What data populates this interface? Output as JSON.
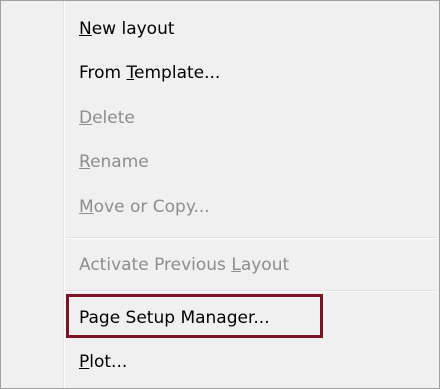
{
  "menu": {
    "items": [
      {
        "pre": "",
        "u": "N",
        "post": "ew layout",
        "enabled": true
      },
      {
        "pre": "From ",
        "u": "T",
        "post": "emplate...",
        "enabled": true
      },
      {
        "pre": "",
        "u": "D",
        "post": "elete",
        "enabled": false
      },
      {
        "pre": "",
        "u": "R",
        "post": "ename",
        "enabled": false
      },
      {
        "pre": "",
        "u": "M",
        "post": "ove or Copy...",
        "enabled": false
      },
      {
        "pre": "Activate Previous ",
        "u": "L",
        "post": "ayout",
        "enabled": false
      },
      {
        "pre": "Page Setup Manager...",
        "u": "",
        "post": "",
        "enabled": true
      },
      {
        "pre": "",
        "u": "P",
        "post": "lot...",
        "enabled": true
      }
    ],
    "highlight_color": "#7a1526",
    "disabled_color": "#8d8d8d"
  }
}
